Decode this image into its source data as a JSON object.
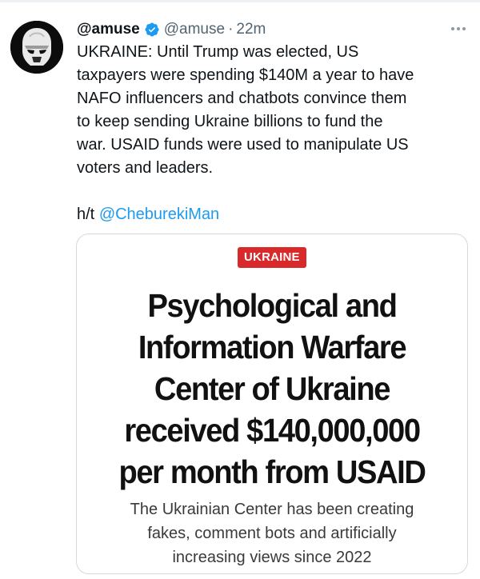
{
  "tweet": {
    "display_name": "@amuse",
    "handle": "@amuse",
    "separator": "·",
    "time": "22m",
    "text_lines": [
      "UKRAINE: Until Trump was elected, US",
      "taxpayers were spending $140M a year to have",
      "NAFO influencers and chatbots convince them",
      "to keep sending Ukraine billions to fund the",
      "war. USAID funds were used to manipulate US",
      "voters and leaders."
    ],
    "hat_tip_prefix": "h/t",
    "hat_tip_mention": "@CheburekiMan"
  },
  "card": {
    "badge": "UKRAINE",
    "headline_lines": [
      "Psychological and",
      "Information Warfare",
      "Center of Ukraine",
      "received $140,000,000",
      "per month from USAID"
    ],
    "subhead_lines": [
      "The Ukrainian Center has been creating",
      "fakes, comment bots and artificially",
      "increasing views since 2022"
    ]
  },
  "colors": {
    "accent": "#1d9bf0",
    "badge": "#d82a2a",
    "muted": "#536471"
  },
  "icons": {
    "verified": "verified-badge-icon",
    "more": "more-options-icon"
  }
}
